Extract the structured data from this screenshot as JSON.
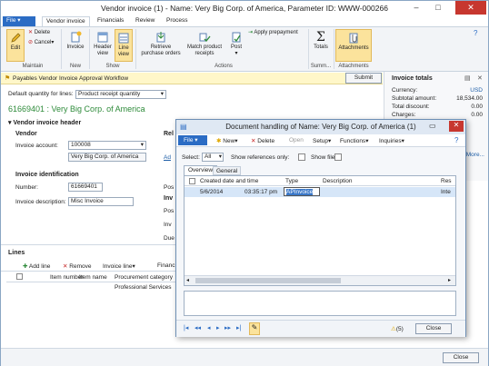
{
  "window": {
    "title": "Vendor invoice (1) - Name: Very Big Corp. of America, Parameter ID: WWW-000266"
  },
  "ribbon_tabs": [
    "File",
    "Vendor invoice",
    "Financials",
    "Review",
    "Process"
  ],
  "ribbon": {
    "edit": "Edit",
    "delete": "Delete",
    "cancel": "Cancel",
    "invoice": "Invoice",
    "header_view": "Header view",
    "line_view": "Line view",
    "retrieve": "Retrieve purchase orders",
    "match": "Match product receipts",
    "post": "Post",
    "apply_prepayment": "Apply prepayment",
    "totals": "Totals",
    "attachments": "Attachments",
    "groups": [
      "Maintain",
      "New",
      "Show",
      "Actions",
      "Summ...",
      "Attachments"
    ]
  },
  "workflow": {
    "label": "Payables Vendor Invoice Approval Workflow",
    "submit": "Submit"
  },
  "default_qty": {
    "label": "Default quantity for lines:",
    "value": "Product receipt quantity"
  },
  "invoice_title": "61669401 : Very Big Corp. of America",
  "header": {
    "section": "Vendor invoice header",
    "vendor_label": "Vendor",
    "account_label": "Invoice account:",
    "account_value": "100008",
    "vendor_name": "Very Big Corp. of America",
    "ident_label": "Invoice identification",
    "number_label": "Number:",
    "number_value": "61669401",
    "desc_label": "Invoice description:",
    "desc_value": "Misc Invoice",
    "cut_labels": [
      "Rel",
      "Pos",
      "Inv",
      "Pos",
      "Inv",
      "Due"
    ],
    "cut_ad": "Ad"
  },
  "invoice_totals": {
    "title": "Invoice totals",
    "rows": [
      {
        "label": "Currency:",
        "value": "USD"
      },
      {
        "label": "Subtotal amount:",
        "value": "18,534.00"
      },
      {
        "label": "Total discount:",
        "value": "0.00"
      },
      {
        "label": "Charges:",
        "value": "0.00"
      }
    ],
    "more": "More..."
  },
  "lines": {
    "title": "Lines",
    "toolbar": [
      "Add line",
      "Remove",
      "Invoice line",
      "Financ"
    ],
    "columns": [
      "Item number",
      "Item name",
      "Procurement category"
    ],
    "row_value": "Professional Services"
  },
  "dialog": {
    "title": "Document handling of Name: Very Big Corp. of America (1)",
    "menu": [
      "File",
      "New",
      "Delete",
      "Open",
      "Setup",
      "Functions",
      "Inquiries"
    ],
    "select_label": "Select:",
    "select_value": "All",
    "show_refs": "Show references only:",
    "show_file": "Show file:",
    "tabs": [
      "Overview",
      "General"
    ],
    "columns": [
      "Created date and time",
      "Type",
      "Description",
      "Res"
    ],
    "row": {
      "date": "5/6/2014",
      "time": "03:35:17 pm",
      "type": "APInvoice",
      "res": "Inte"
    },
    "count": "(5)",
    "close": "Close"
  },
  "status_close": "Close"
}
